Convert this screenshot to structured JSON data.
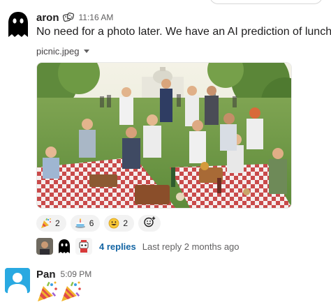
{
  "messages": [
    {
      "sender": "aron",
      "status_emoji": "dice-icon",
      "time": "11:16 AM",
      "text": "No need for a photo later. We have an AI prediction of lunch",
      "attachment": {
        "filename": "picnic.jpeg",
        "image_description_icon": "picnic-scene-image"
      },
      "reactions": [
        {
          "emoji": "party-popper-icon",
          "count": "2"
        },
        {
          "emoji": "cake-icon",
          "count": "6"
        },
        {
          "emoji": "grinning-face-icon",
          "count": "2"
        }
      ],
      "thread": {
        "replies": "4 replies",
        "last_reply": "Last reply 2 months ago"
      }
    },
    {
      "sender": "Pan",
      "time": "5:09 PM",
      "emojis": [
        "party-popper-icon",
        "party-popper-icon"
      ]
    }
  ],
  "colors": {
    "link": "#1264a3",
    "muted": "#616061",
    "reaction_bg": "#f2f2f2",
    "avatar_pan": "#29a9e1"
  }
}
